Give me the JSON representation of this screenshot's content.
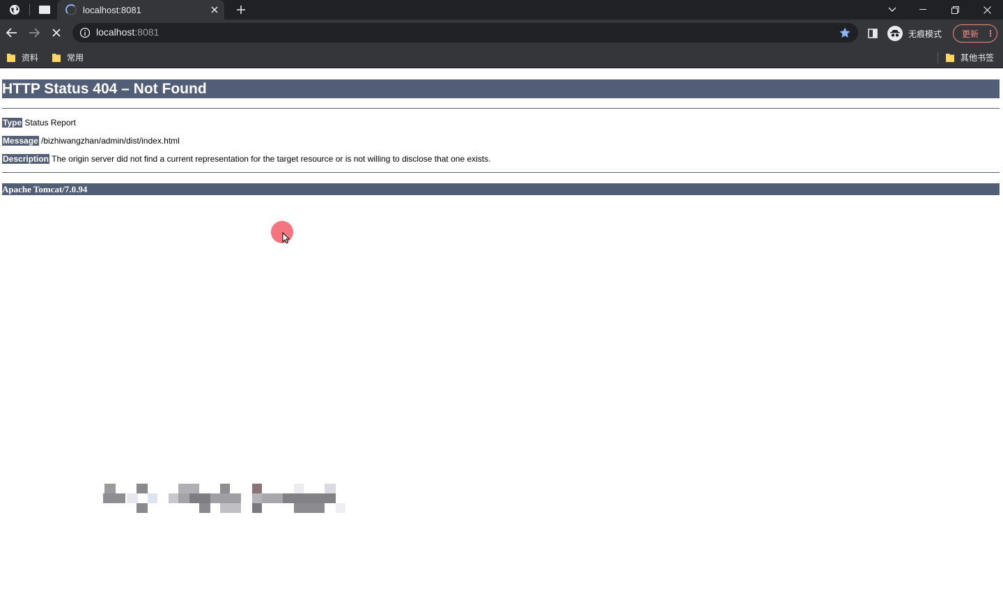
{
  "browser": {
    "tab": {
      "title": "localhost:8081"
    },
    "omnibox": {
      "host": "localhost",
      "port": ":8081"
    },
    "incognito_label": "无痕模式",
    "update_label": "更新",
    "bookmarks": [
      {
        "label": "资料",
        "icon": "folder-icon"
      },
      {
        "label": "常用",
        "icon": "folder-icon"
      }
    ],
    "other_bookmarks": "其他书签",
    "colors": {
      "chrome_dark": "#202124",
      "chrome_mid": "#35363a",
      "accent": "#8ab4f8",
      "update": "#f28b82"
    }
  },
  "page": {
    "heading": "HTTP Status 404 – Not Found",
    "type_label": "Type",
    "type_value": "Status Report",
    "message_label": "Message",
    "message_value": "/bizhiwangzhan/admin/dist/index.html",
    "description_label": "Description",
    "description_value": "The origin server did not find a current representation for the target resource or is not willing to disclose that one exists.",
    "footer": "Apache Tomcat/7.0.94",
    "colors": {
      "header_bg": "#525d76"
    }
  }
}
